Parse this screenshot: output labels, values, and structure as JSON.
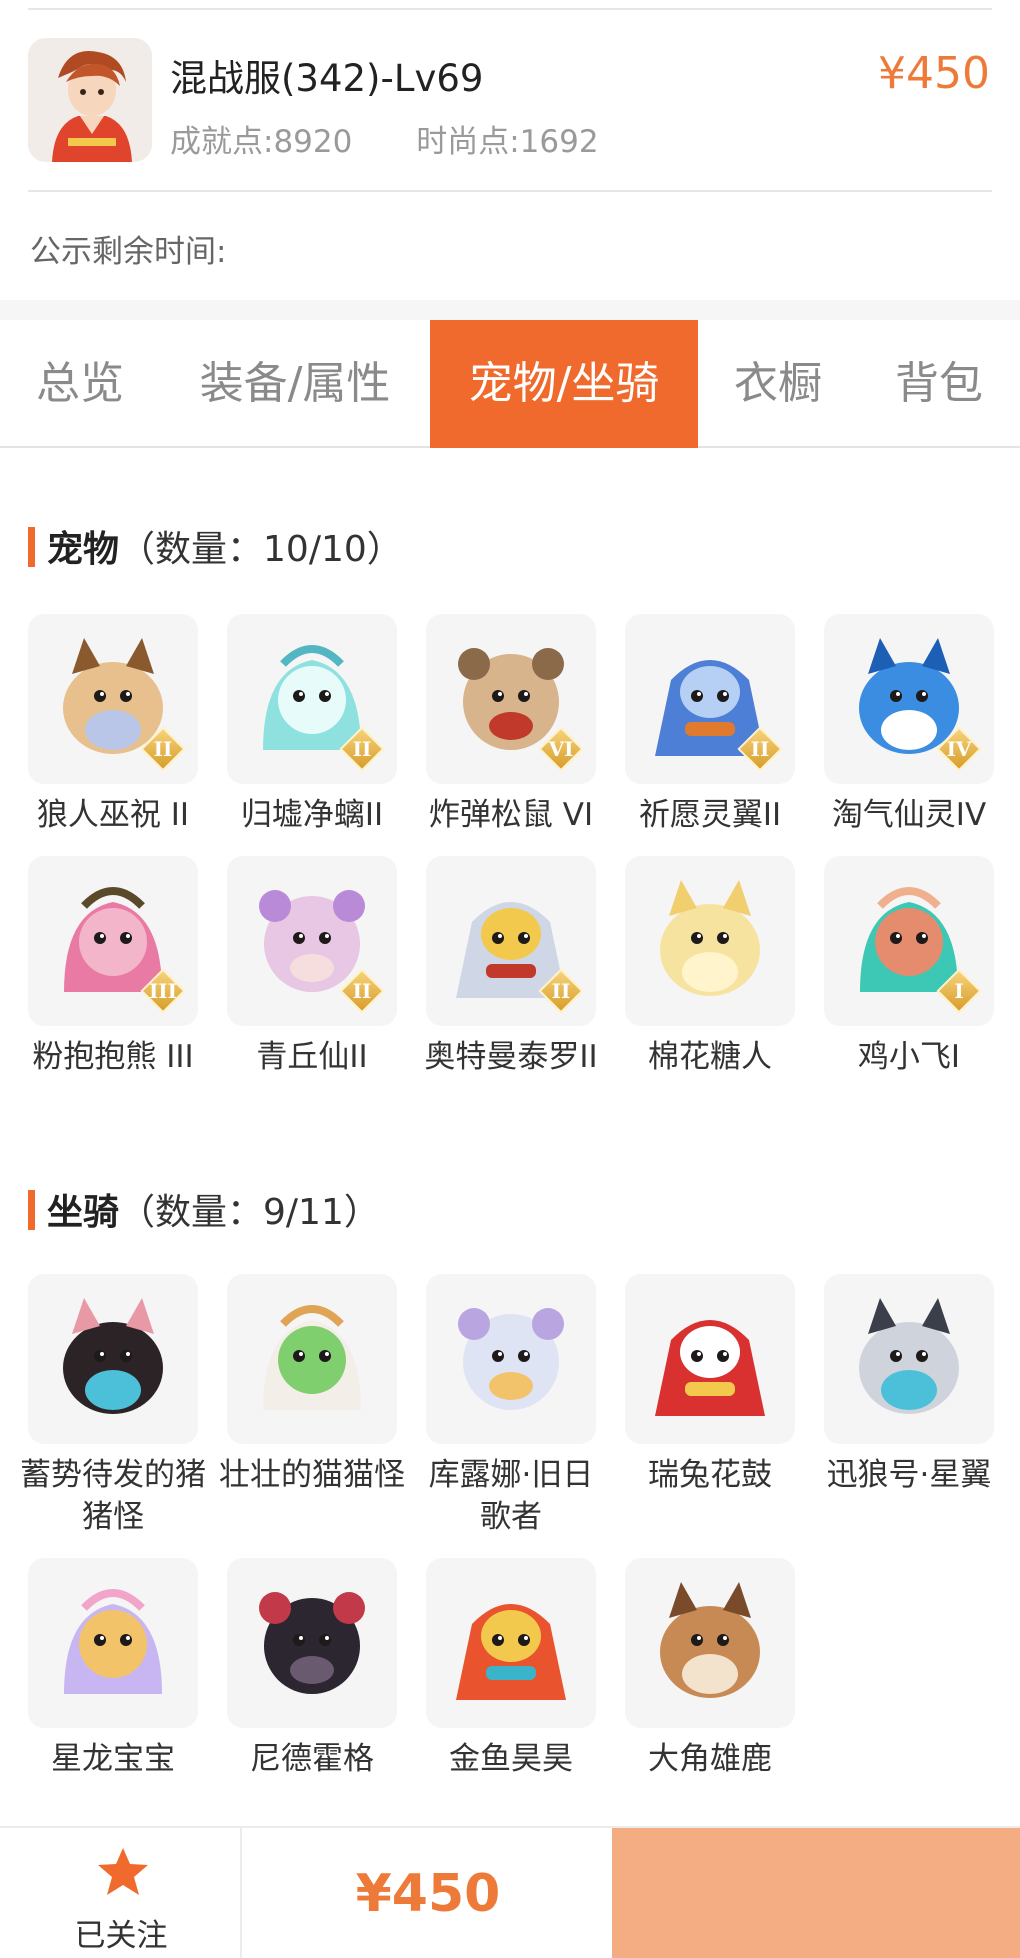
{
  "listing": {
    "server_level": "混战服(342)-Lv69",
    "achievement_label": "成就点:8920",
    "fashion_label": "时尚点:1692",
    "price": "¥450",
    "notice_label": "公示剩余时间:"
  },
  "tabs": [
    {
      "label": "总览",
      "active": false
    },
    {
      "label": "装备/属性",
      "active": false
    },
    {
      "label": "宠物/坐骑",
      "active": true
    },
    {
      "label": "衣橱",
      "active": false
    },
    {
      "label": "背包",
      "active": false
    }
  ],
  "pets": {
    "title": "宠物",
    "count_label": "（数量：10/10）",
    "items": [
      {
        "name": "狼人巫祝 II",
        "rank": "II",
        "icon": "werewolf-shaman-pet-icon",
        "colors": [
          "#e7c08d",
          "#8a5a2e",
          "#b9c6e8"
        ]
      },
      {
        "name": "归墟净螭II",
        "rank": "II",
        "icon": "jade-dragon-pet-icon",
        "colors": [
          "#8fe1e0",
          "#52b7c2",
          "#e8fbfb"
        ]
      },
      {
        "name": "炸弹松鼠 VI",
        "rank": "VI",
        "icon": "bomb-squirrel-pet-icon",
        "colors": [
          "#d7b48b",
          "#8b6a4a",
          "#c0392b"
        ]
      },
      {
        "name": "祈愿灵翼II",
        "rank": "II",
        "icon": "wish-griffin-pet-icon",
        "colors": [
          "#4d7fd6",
          "#e07a2e",
          "#b6d0f5"
        ]
      },
      {
        "name": "淘气仙灵IV",
        "rank": "IV",
        "icon": "naughty-fairy-dog-pet-icon",
        "colors": [
          "#3a8de0",
          "#1d5fb5",
          "#ffffff"
        ]
      },
      {
        "name": "粉抱抱熊 III",
        "rank": "III",
        "icon": "pink-bear-pet-icon",
        "colors": [
          "#e97aa3",
          "#5a4a2a",
          "#f2b5c9"
        ]
      },
      {
        "name": "青丘仙II",
        "rank": "II",
        "icon": "fox-fairy-pet-icon",
        "colors": [
          "#e7c7e4",
          "#b88ad8",
          "#f6dede"
        ]
      },
      {
        "name": "奥特曼泰罗II",
        "rank": "II",
        "icon": "ultraman-taro-pet-icon",
        "colors": [
          "#cfd6e6",
          "#c0392b",
          "#f2c94c"
        ]
      },
      {
        "name": "棉花糖人",
        "rank": "",
        "icon": "marshmallow-pet-icon",
        "colors": [
          "#f7e3a0",
          "#f2cf6e",
          "#fff4cc"
        ]
      },
      {
        "name": "鸡小飞I",
        "rank": "I",
        "icon": "chick-pet-icon",
        "colors": [
          "#3dc7b5",
          "#f0b08e",
          "#e58b6e"
        ]
      }
    ]
  },
  "mounts": {
    "title": "坐骑",
    "count_label": "（数量：9/11）",
    "items": [
      {
        "name": "蓄势待发的猪猪怪",
        "icon": "black-pig-mount-icon",
        "colors": [
          "#2b2326",
          "#e79aa6",
          "#4cc0d8"
        ]
      },
      {
        "name": "壮壮的猫猫怪",
        "icon": "calico-cat-mount-icon",
        "colors": [
          "#f3efe8",
          "#e0a456",
          "#7fcf6e"
        ]
      },
      {
        "name": "库露娜·旧日歌者",
        "icon": "kuluna-singer-mount-icon",
        "colors": [
          "#dfe4f4",
          "#b9a6e0",
          "#f2c36a"
        ]
      },
      {
        "name": "瑞兔花鼓",
        "icon": "rabbit-drum-mount-icon",
        "colors": [
          "#d9312f",
          "#f2c94c",
          "#ffffff"
        ]
      },
      {
        "name": "迅狼号·星翼",
        "icon": "mech-wolf-mount-icon",
        "colors": [
          "#cfd4dc",
          "#3a3f4a",
          "#4cc0d8"
        ]
      },
      {
        "name": "星龙宝宝",
        "icon": "star-dragon-baby-mount-icon",
        "colors": [
          "#c8b6f2",
          "#f2a5c8",
          "#f3c36a"
        ]
      },
      {
        "name": "尼德霍格",
        "icon": "nidhogg-dragon-mount-icon",
        "colors": [
          "#2c2630",
          "#c23a4a",
          "#6a5a70"
        ]
      },
      {
        "name": "金鱼昊昊",
        "icon": "goldfish-mount-icon",
        "colors": [
          "#e9532d",
          "#3bb3c8",
          "#f2c94c"
        ]
      },
      {
        "name": "大角雄鹿",
        "icon": "stag-mount-icon",
        "colors": [
          "#c88a55",
          "#7a4b2a",
          "#f3e2cc"
        ]
      }
    ]
  },
  "footer": {
    "follow_label": "已关注",
    "price": "¥450",
    "accent": "#ee7a3a",
    "buy_button_color": "#f4ac82"
  },
  "colors": {
    "accent": "#ef6a2c",
    "price": "#ee7a3a"
  }
}
